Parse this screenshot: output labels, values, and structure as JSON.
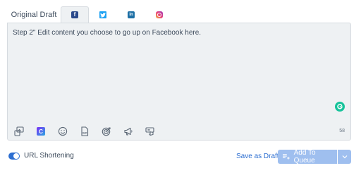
{
  "tabs": [
    {
      "label": "Original Draft",
      "icon": null,
      "active": false
    },
    {
      "label": "",
      "icon": "facebook-icon",
      "active": true
    },
    {
      "label": "",
      "icon": "twitter-icon",
      "active": false
    },
    {
      "label": "",
      "icon": "linkedin-icon",
      "active": false
    },
    {
      "label": "",
      "icon": "instagram-icon",
      "active": false
    }
  ],
  "editor": {
    "text": "Step 2\" Edit content you choose to go up on Facebook here.",
    "char_count": "58"
  },
  "toolbar_icons": [
    "media-upload-icon",
    "canva-icon",
    "emoji-icon",
    "gif-icon",
    "target-icon",
    "megaphone-icon",
    "hashtag-manager-icon"
  ],
  "footer": {
    "url_shortening_label": "URL Shortening",
    "url_shortening_on": true,
    "save_as_draft": "Save as Draft",
    "add_to_queue": "Add To Queue"
  },
  "colors": {
    "accent": "#2c6ed1",
    "button_disabled": "#9fbfef",
    "editor_bg": "#eef1f3",
    "grammarly": "#15c39a"
  }
}
